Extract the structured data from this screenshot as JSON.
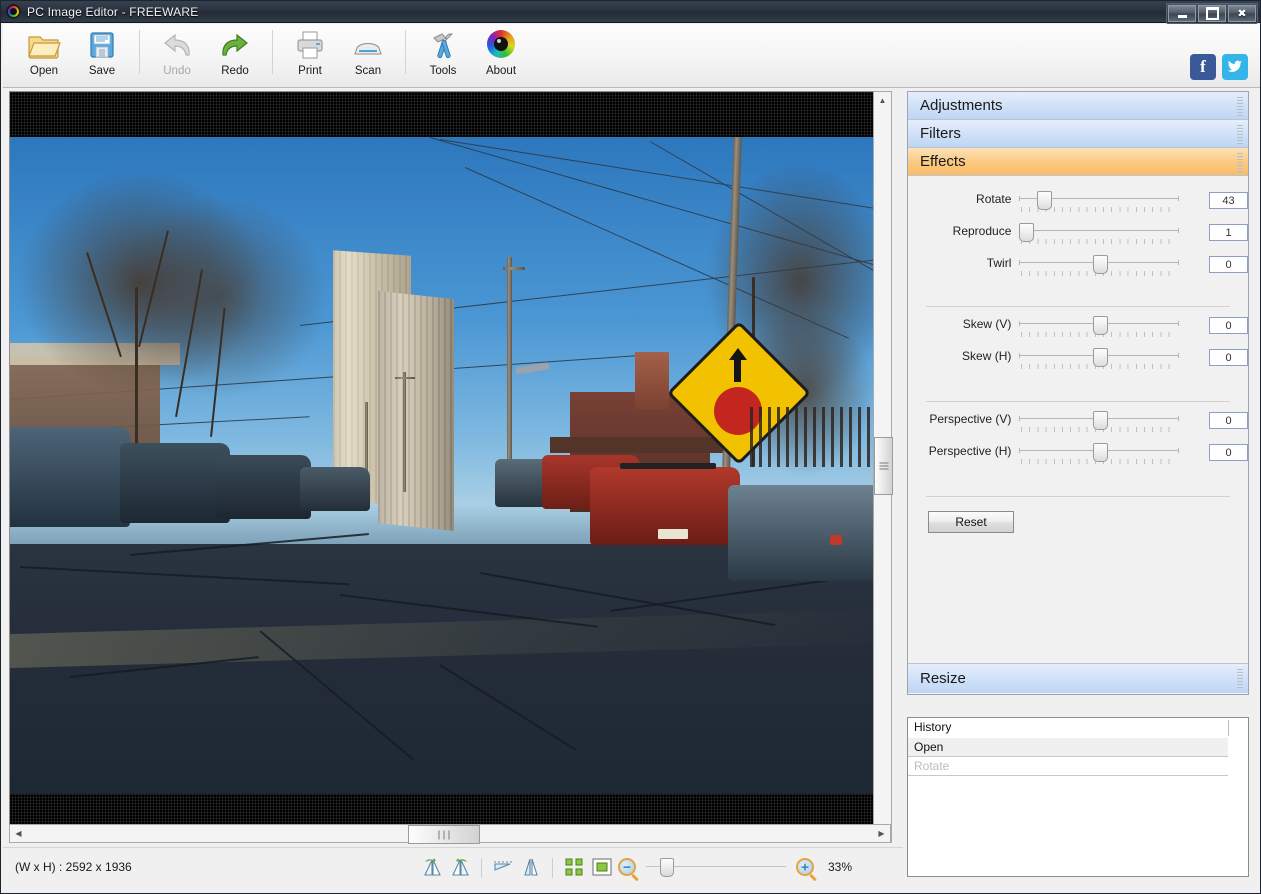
{
  "window": {
    "title": "PC Image Editor - FREEWARE",
    "app_icon": "color-wheel-icon",
    "buttons": {
      "minimize": "minimize-icon",
      "maximize": "maximize-icon",
      "close": "✖"
    }
  },
  "toolbar": {
    "items": [
      {
        "label": "Open",
        "icon": "open-folder-icon",
        "disabled": false
      },
      {
        "label": "Save",
        "icon": "floppy-disk-icon",
        "disabled": false
      },
      {
        "label": "Undo",
        "icon": "undo-arrow-icon",
        "disabled": true
      },
      {
        "label": "Redo",
        "icon": "redo-arrow-icon",
        "disabled": false
      },
      {
        "label": "Print",
        "icon": "printer-icon",
        "disabled": false
      },
      {
        "label": "Scan",
        "icon": "scanner-icon",
        "disabled": false
      },
      {
        "label": "Tools",
        "icon": "hammer-wrench-icon",
        "disabled": false
      },
      {
        "label": "About",
        "icon": "color-eye-icon",
        "disabled": false
      }
    ],
    "social": [
      {
        "name": "facebook-icon",
        "glyph": "f",
        "color": "#3b5998"
      },
      {
        "name": "twitter-icon",
        "glyph": "🐦",
        "color": "#35b4ea"
      }
    ]
  },
  "panels": {
    "sections": [
      {
        "label": "Adjustments",
        "state": "collapsed"
      },
      {
        "label": "Filters",
        "state": "collapsed"
      },
      {
        "label": "Effects",
        "state": "expanded"
      },
      {
        "label": "Resize",
        "state": "collapsed"
      }
    ],
    "effects": {
      "sliders": [
        {
          "label": "Rotate",
          "value": "43",
          "pos_pct": 13
        },
        {
          "label": "Reproduce",
          "value": "1",
          "pos_pct": 0
        },
        {
          "label": "Twirl",
          "value": "0",
          "pos_pct": 50
        },
        {
          "label": "Skew (V)",
          "value": "0",
          "pos_pct": 50
        },
        {
          "label": "Skew (H)",
          "value": "0",
          "pos_pct": 50
        },
        {
          "label": "Perspective (V)",
          "value": "0",
          "pos_pct": 50
        },
        {
          "label": "Perspective (H)",
          "value": "0",
          "pos_pct": 50
        }
      ],
      "reset_label": "Reset"
    }
  },
  "history": {
    "header": "History",
    "entries": [
      {
        "label": "Open",
        "state": "selected"
      },
      {
        "label": "Rotate",
        "state": "dimmed"
      }
    ]
  },
  "statusbar": {
    "dimensions": "(W x H) : 2592 x 1936",
    "tools": [
      {
        "name": "rotate-left-icon"
      },
      {
        "name": "rotate-right-icon"
      },
      {
        "name": "flip-vertical-icon"
      },
      {
        "name": "flip-horizontal-icon"
      },
      {
        "name": "fit-to-window-icon"
      },
      {
        "name": "actual-size-icon"
      }
    ],
    "zoom_out_icon": "zoom-out-icon",
    "zoom_in_icon": "zoom-in-icon",
    "zoom_level": "33%",
    "zoom_slider_pct": 10
  },
  "canvas": {
    "photo_description": "street-scene-photo",
    "vertical_scroll_pct": 48,
    "horizontal_scroll_pct": 49
  }
}
